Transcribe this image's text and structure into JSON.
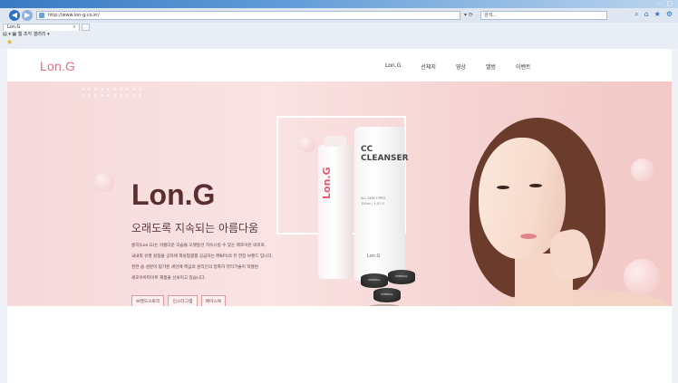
{
  "browser": {
    "url": "http://www.lon-g.co.kr/",
    "url_tools": "▾ ⟳",
    "search_placeholder": "검색...",
    "tab_title": "Lon.G",
    "favorites_bar": "▤ ▾  ▦ 웹 조각 갤러리 ▾",
    "icons": [
      "back-icon",
      "forward-icon",
      "home-icon",
      "star-icon",
      "gear-icon"
    ]
  },
  "site": {
    "logo": "Lon.G",
    "nav": [
      "Lon.G",
      "선체지",
      "영상",
      "앨범",
      "이벤트"
    ],
    "hero": {
      "title": "Lon.G",
      "subtitle": "오래도록 지속되는 아름다움",
      "description": [
        "롱지(Lon.G)는 아름다운 모습을 오랫동안 지속시킬 수 있는 제조어린 의미로,",
        "국내외 유명 갈점을 공자에 화실험결를 공급하는 ㈜KP1의 뷰 한장 브랜드 입니다.",
        "천연 숍 성분이 탑가된 세인에 핵심의 원리인의 접촉하 뷰터기술이 적절된",
        "세모우아파이트 제품을 선보이고 있습니다."
      ],
      "buttons": [
        "브랜드스토리",
        "인스타그램",
        "페이스북"
      ]
    },
    "product": {
      "pink_tube_label": "Lon.G",
      "white_tube_heading": "CC\nCLEANSER",
      "white_tube_small": "ALL SKIN TYPES\n150ml / 5.07 fl",
      "white_tube_brand": "Lon.G",
      "jar_label": "MINERAL"
    }
  },
  "colors": {
    "accent": "#e06f7e",
    "hero_bg": "#f6d9da",
    "headline": "#5a2f2f"
  }
}
